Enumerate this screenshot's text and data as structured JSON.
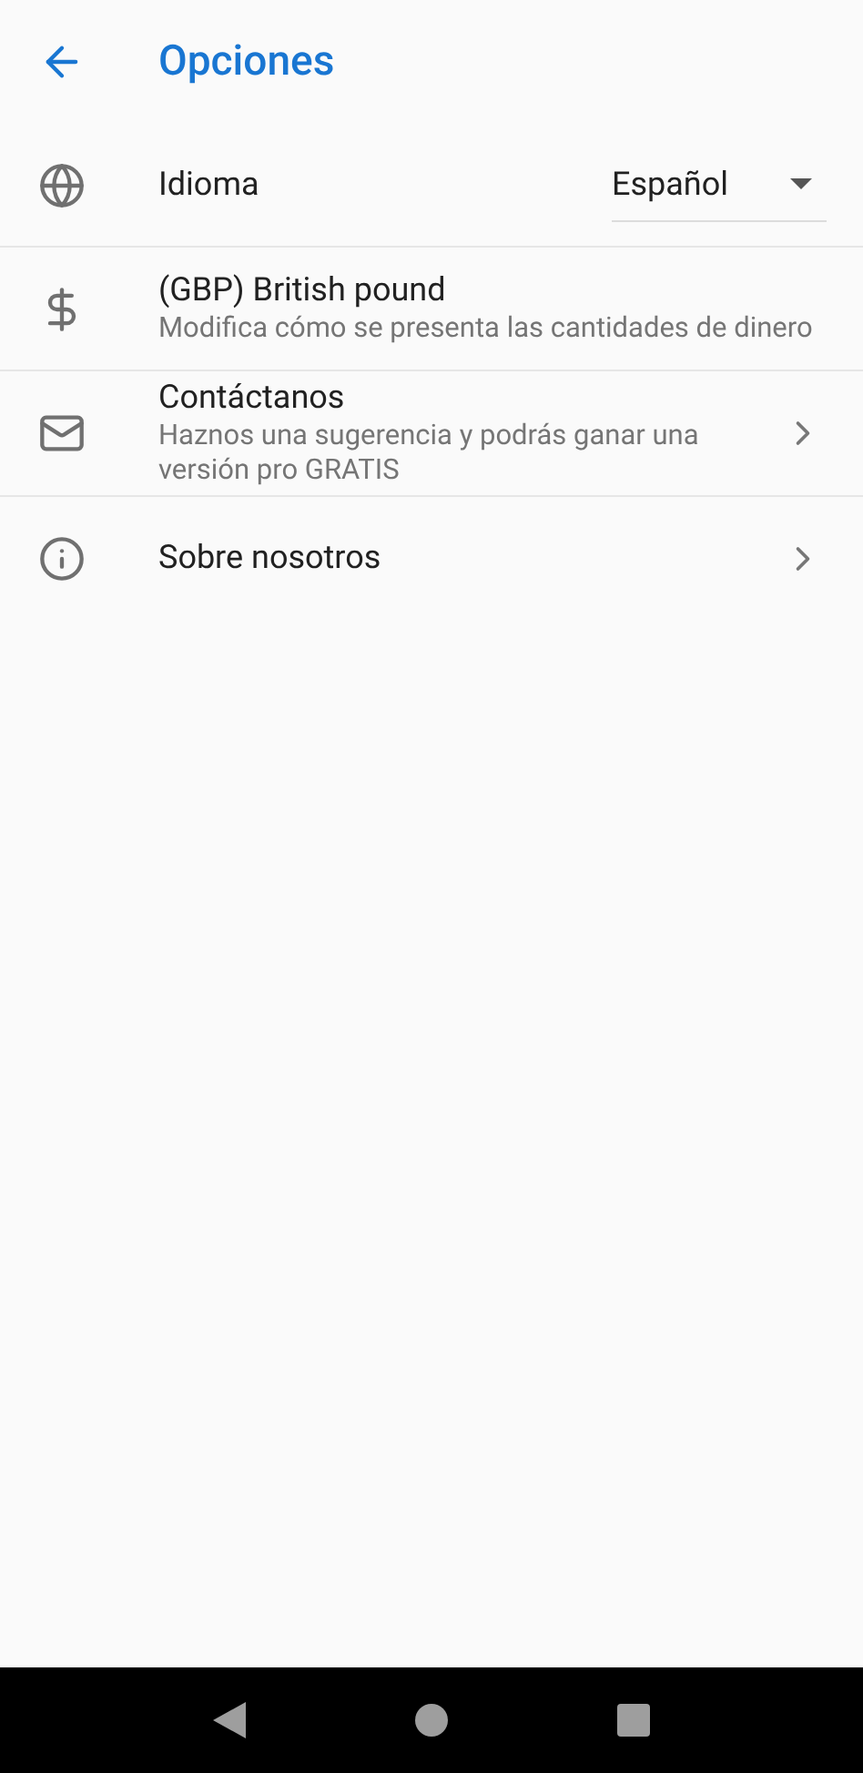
{
  "header": {
    "title": "Opciones"
  },
  "items": [
    {
      "kind": "dropdown",
      "title": "Idioma",
      "value": "Español"
    },
    {
      "kind": "plain",
      "title": "(GBP) British pound",
      "subtitle": "Modifica cómo se presenta las cantidades de dinero"
    },
    {
      "kind": "link",
      "title": "Contáctanos",
      "subtitle": "Haznos una sugerencia y podrás ganar una versión pro GRATIS"
    },
    {
      "kind": "link",
      "title": "Sobre nosotros"
    }
  ]
}
